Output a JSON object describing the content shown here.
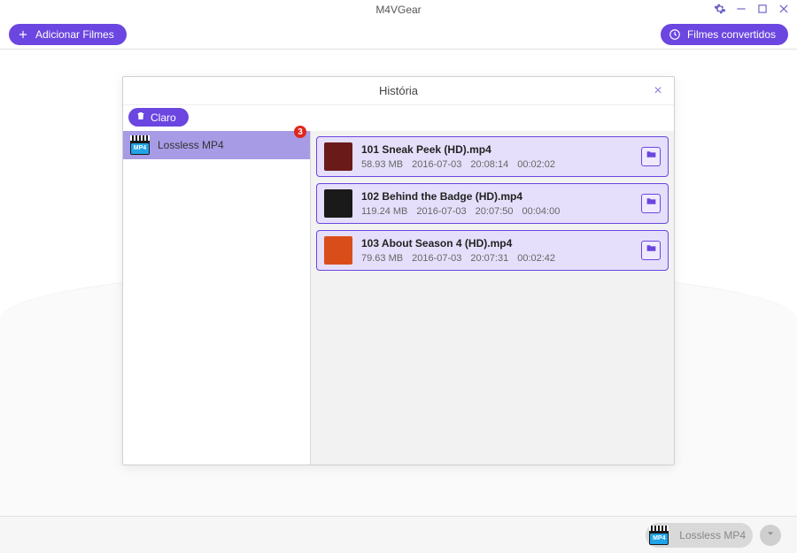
{
  "app": {
    "title": "M4VGear"
  },
  "toolbar": {
    "add_label": "Adicionar Filmes",
    "converted_label": "Filmes convertidos"
  },
  "dialog": {
    "title": "História",
    "clear_label": "Claro",
    "category": {
      "name": "Lossless MP4",
      "icon_text": "MP4",
      "badge": "3"
    },
    "files": [
      {
        "title": "101 Sneak Peek (HD).mp4",
        "size": "58.93 MB",
        "date": "2016-07-03",
        "time": "20:08:14",
        "duration": "00:02:02",
        "thumb_bg": "#6b1a1a",
        "thumb_txt": ""
      },
      {
        "title": "102 Behind the Badge (HD).mp4",
        "size": "119.24 MB",
        "date": "2016-07-03",
        "time": "20:07:50",
        "duration": "00:04:00",
        "thumb_bg": "#1a1a1a",
        "thumb_txt": ""
      },
      {
        "title": "103 About Season 4 (HD).mp4",
        "size": "79.63 MB",
        "date": "2016-07-03",
        "time": "20:07:31",
        "duration": "00:02:42",
        "thumb_bg": "#d94d1a",
        "thumb_txt": ""
      }
    ]
  },
  "footer": {
    "format_label": "Lossless MP4",
    "format_icon_text": "MP4"
  },
  "colors": {
    "accent": "#6b46e0",
    "accent_light": "#a89be6",
    "card_bg": "#e5dffb",
    "badge": "#e1261c"
  }
}
